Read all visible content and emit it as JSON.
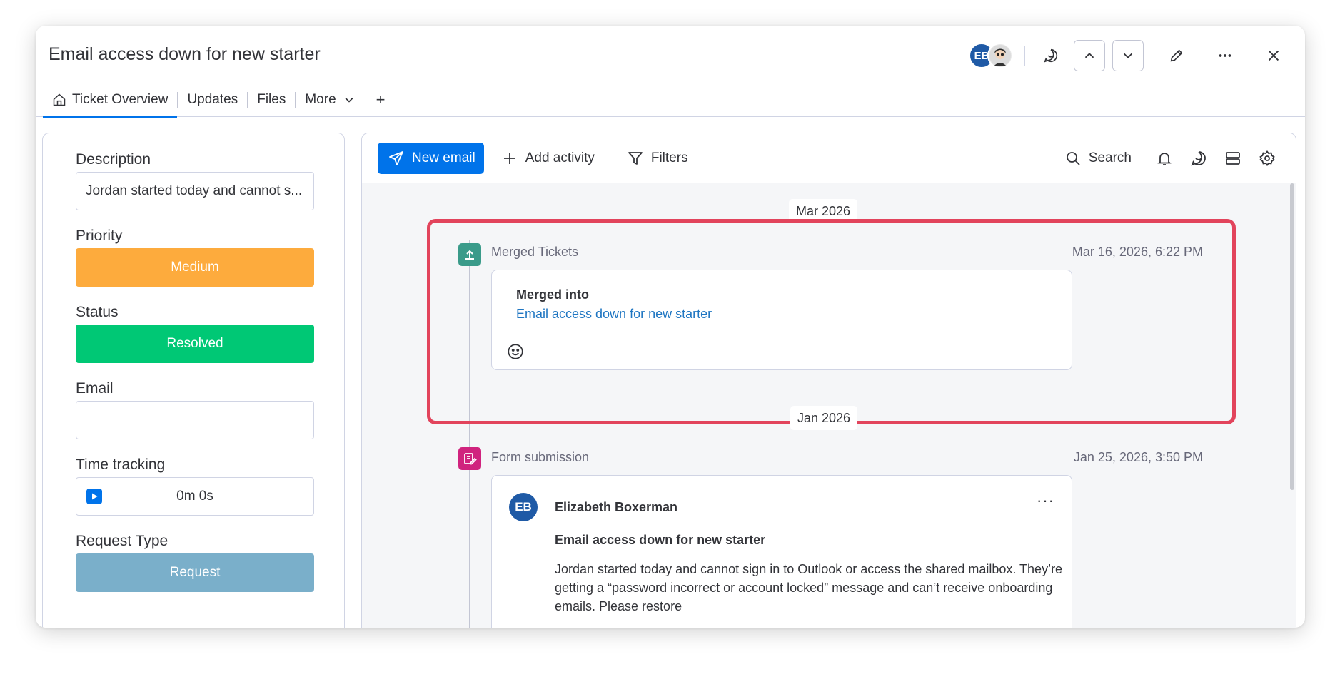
{
  "header": {
    "title": "Email access down for new starter",
    "tabs": [
      {
        "label": "Ticket Overview",
        "active": true,
        "icon": "home-icon"
      },
      {
        "label": "Updates"
      },
      {
        "label": "Files"
      },
      {
        "label": "More",
        "icon": "chevron-down-icon"
      }
    ],
    "add_tab_label": "+",
    "avatar_initials": "EB",
    "icons": [
      "chat-icon",
      "chevron-up-icon",
      "chevron-down-icon",
      "pencil-icon",
      "more-icon",
      "close-icon"
    ]
  },
  "left_panel": {
    "description": {
      "label": "Description",
      "value": "Jordan started today and cannot s..."
    },
    "priority": {
      "label": "Priority",
      "value": "Medium",
      "color": "#fdab3d"
    },
    "status": {
      "label": "Status",
      "value": "Resolved",
      "color": "#00c875"
    },
    "email": {
      "label": "Email",
      "value": ""
    },
    "time_tracking": {
      "label": "Time tracking",
      "value": "0m 0s"
    },
    "request_type": {
      "label": "Request Type",
      "value": "Request",
      "color": "#7aafca"
    }
  },
  "toolbar": {
    "new_email": "New email",
    "add_activity": "Add activity",
    "filters": "Filters",
    "search": "Search"
  },
  "timeline": {
    "groups": [
      {
        "month": "Mar 2026",
        "activity": {
          "type": "Merged Tickets",
          "timestamp": "Mar 16, 2026, 6:22 PM",
          "icon_color": "#3a9b8a",
          "merged_label": "Merged into",
          "merged_link": "Email access down for new starter"
        }
      },
      {
        "month": "Jan 2026",
        "activity": {
          "type": "Form submission",
          "timestamp": "Jan 25, 2026, 3:50 PM",
          "icon_color": "#d0237e",
          "author_initials": "EB",
          "author": "Elizabeth Boxerman",
          "subject": "Email access down for new starter",
          "body": "Jordan started today and cannot sign in to Outlook or access the shared mailbox. They’re getting a “password incorrect or account locked” message and can’t receive onboarding emails. Please restore"
        }
      }
    ]
  },
  "colors": {
    "accent": "#0073ea",
    "highlight": "#e2445c",
    "link": "#1f76c2"
  }
}
